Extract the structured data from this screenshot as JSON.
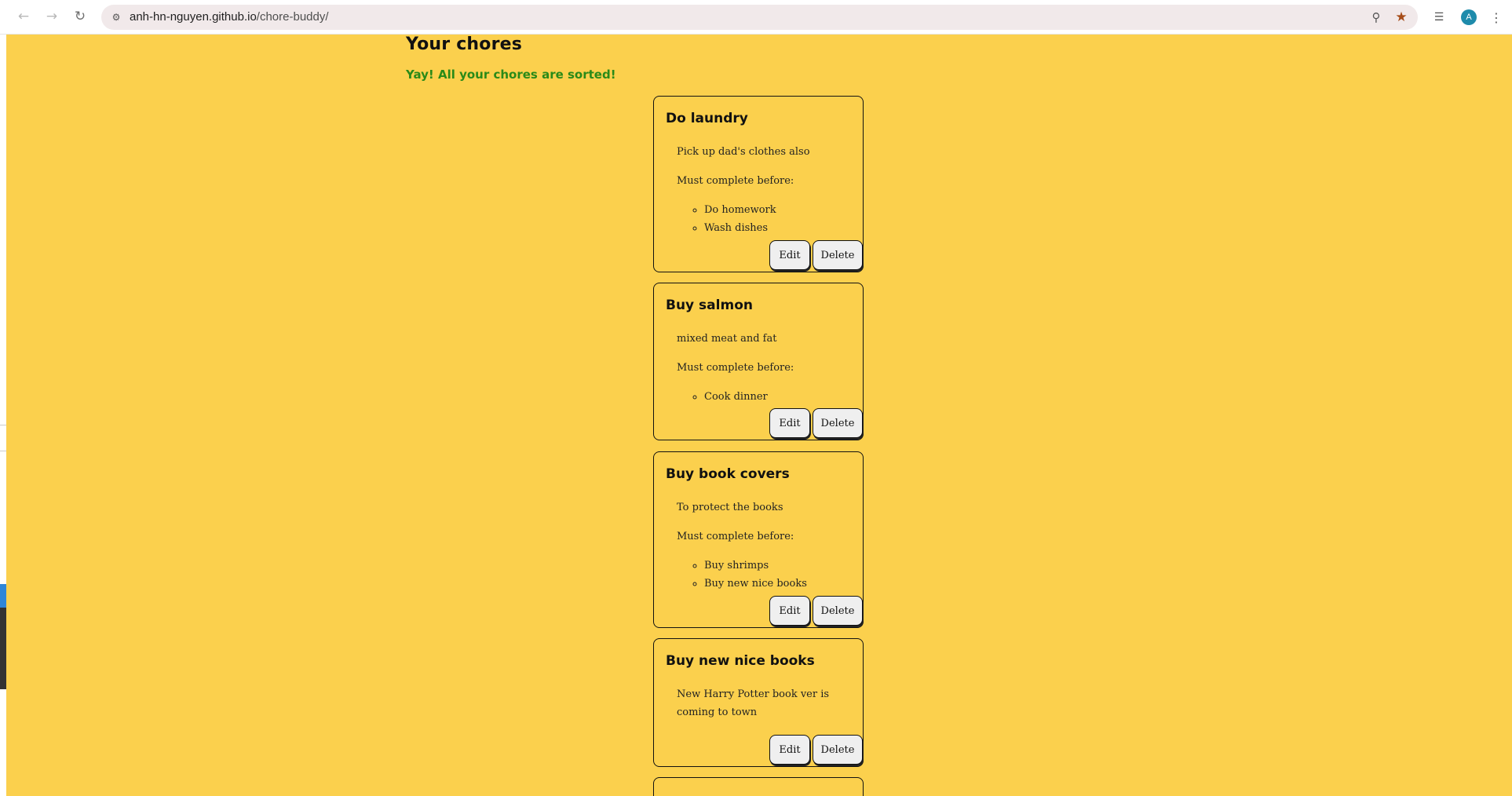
{
  "browser": {
    "url_host": "anh-hn-nguyen.github.io",
    "url_path": "/chore-buddy/",
    "profile_initial": "A",
    "icons": [
      "back-arrow-icon",
      "forward-arrow-icon",
      "reload-icon",
      "site-info-icon",
      "zoom-icon",
      "bookmark-star-icon",
      "reading-list-icon",
      "profile-avatar",
      "more-menu-icon"
    ]
  },
  "page": {
    "title": "Your chores",
    "status_message": "Yay! All your chores are sorted!",
    "colors": {
      "background": "#fbd04d",
      "success_text": "#2a8a18",
      "button_bg": "#efefef"
    }
  },
  "chores": [
    {
      "title": "Do laundry",
      "description": "Pick up dad's clothes also",
      "dependency_label": "Must complete before:",
      "dependencies": [
        "Do homework",
        "Wash dishes"
      ],
      "edit_label": "Edit",
      "delete_label": "Delete"
    },
    {
      "title": "Buy salmon",
      "description": "mixed meat and fat",
      "dependency_label": "Must complete before:",
      "dependencies": [
        "Cook dinner"
      ],
      "edit_label": "Edit",
      "delete_label": "Delete"
    },
    {
      "title": "Buy book covers",
      "description": "To protect the books",
      "dependency_label": "Must complete before:",
      "dependencies": [
        "Buy shrimps",
        "Buy new nice books"
      ],
      "edit_label": "Edit",
      "delete_label": "Delete"
    },
    {
      "title": "Buy new nice books",
      "description": "New Harry Potter book ver is coming to town",
      "edit_label": "Edit",
      "delete_label": "Delete"
    }
  ]
}
